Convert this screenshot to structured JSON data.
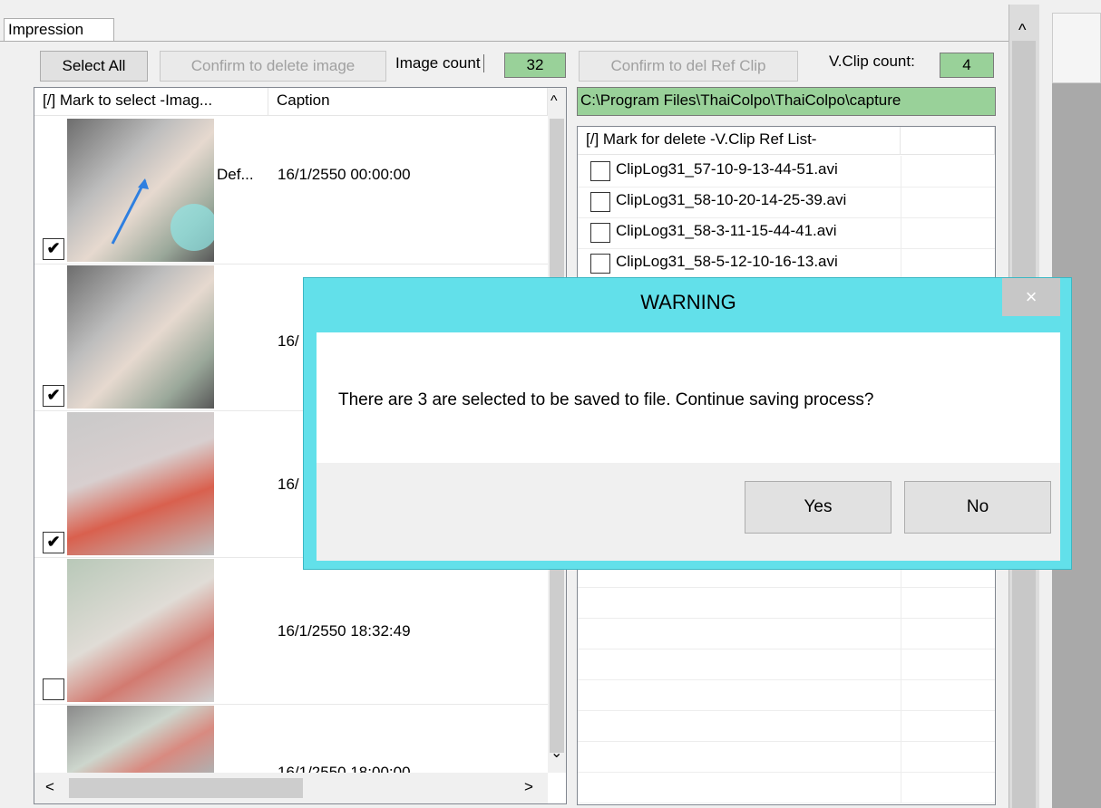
{
  "tab": {
    "label": "Impression"
  },
  "toolbar": {
    "select_all": "Select All",
    "confirm_delete_image": "Confirm to delete image",
    "image_count_label": "Image count",
    "image_count_value": "32",
    "confirm_del_clip": "Confirm to del Ref Clip",
    "vclip_count_label": "V.Clip count:",
    "vclip_count_value": "4"
  },
  "image_list": {
    "columns": [
      "[/] Mark to select -Imag...",
      "Caption"
    ],
    "rows": [
      {
        "checked": true,
        "name": "Def...",
        "caption": "16/1/2550 00:00:00"
      },
      {
        "checked": true,
        "name": "",
        "caption": "16/"
      },
      {
        "checked": true,
        "name": "",
        "caption": "16/"
      },
      {
        "checked": false,
        "name": "",
        "caption": "16/1/2550 18:32:49"
      },
      {
        "checked": false,
        "name": "",
        "caption": "16/1/2550 18:00:00"
      }
    ]
  },
  "clip_panel": {
    "path": "C:\\Program Files\\ThaiColpo\\ThaiColpo\\capture",
    "columns": [
      "[/] Mark for delete -V.Clip Ref List-",
      ""
    ],
    "rows": [
      "ClipLog31_57-10-9-13-44-51.avi",
      "ClipLog31_58-10-20-14-25-39.avi",
      "ClipLog31_58-3-11-15-44-41.avi",
      "ClipLog31_58-5-12-10-16-13.avi"
    ]
  },
  "dialog": {
    "title": "WARNING",
    "close": "×",
    "message": "There are 3 are selected to be saved to file. Continue saving process?",
    "yes": "Yes",
    "no": "No"
  },
  "scroll": {
    "up": "^",
    "down": "⌄",
    "left": "<",
    "right": ">"
  },
  "colors": {
    "dialog_frame": "#62e0ea",
    "count_box": "#99d199"
  }
}
